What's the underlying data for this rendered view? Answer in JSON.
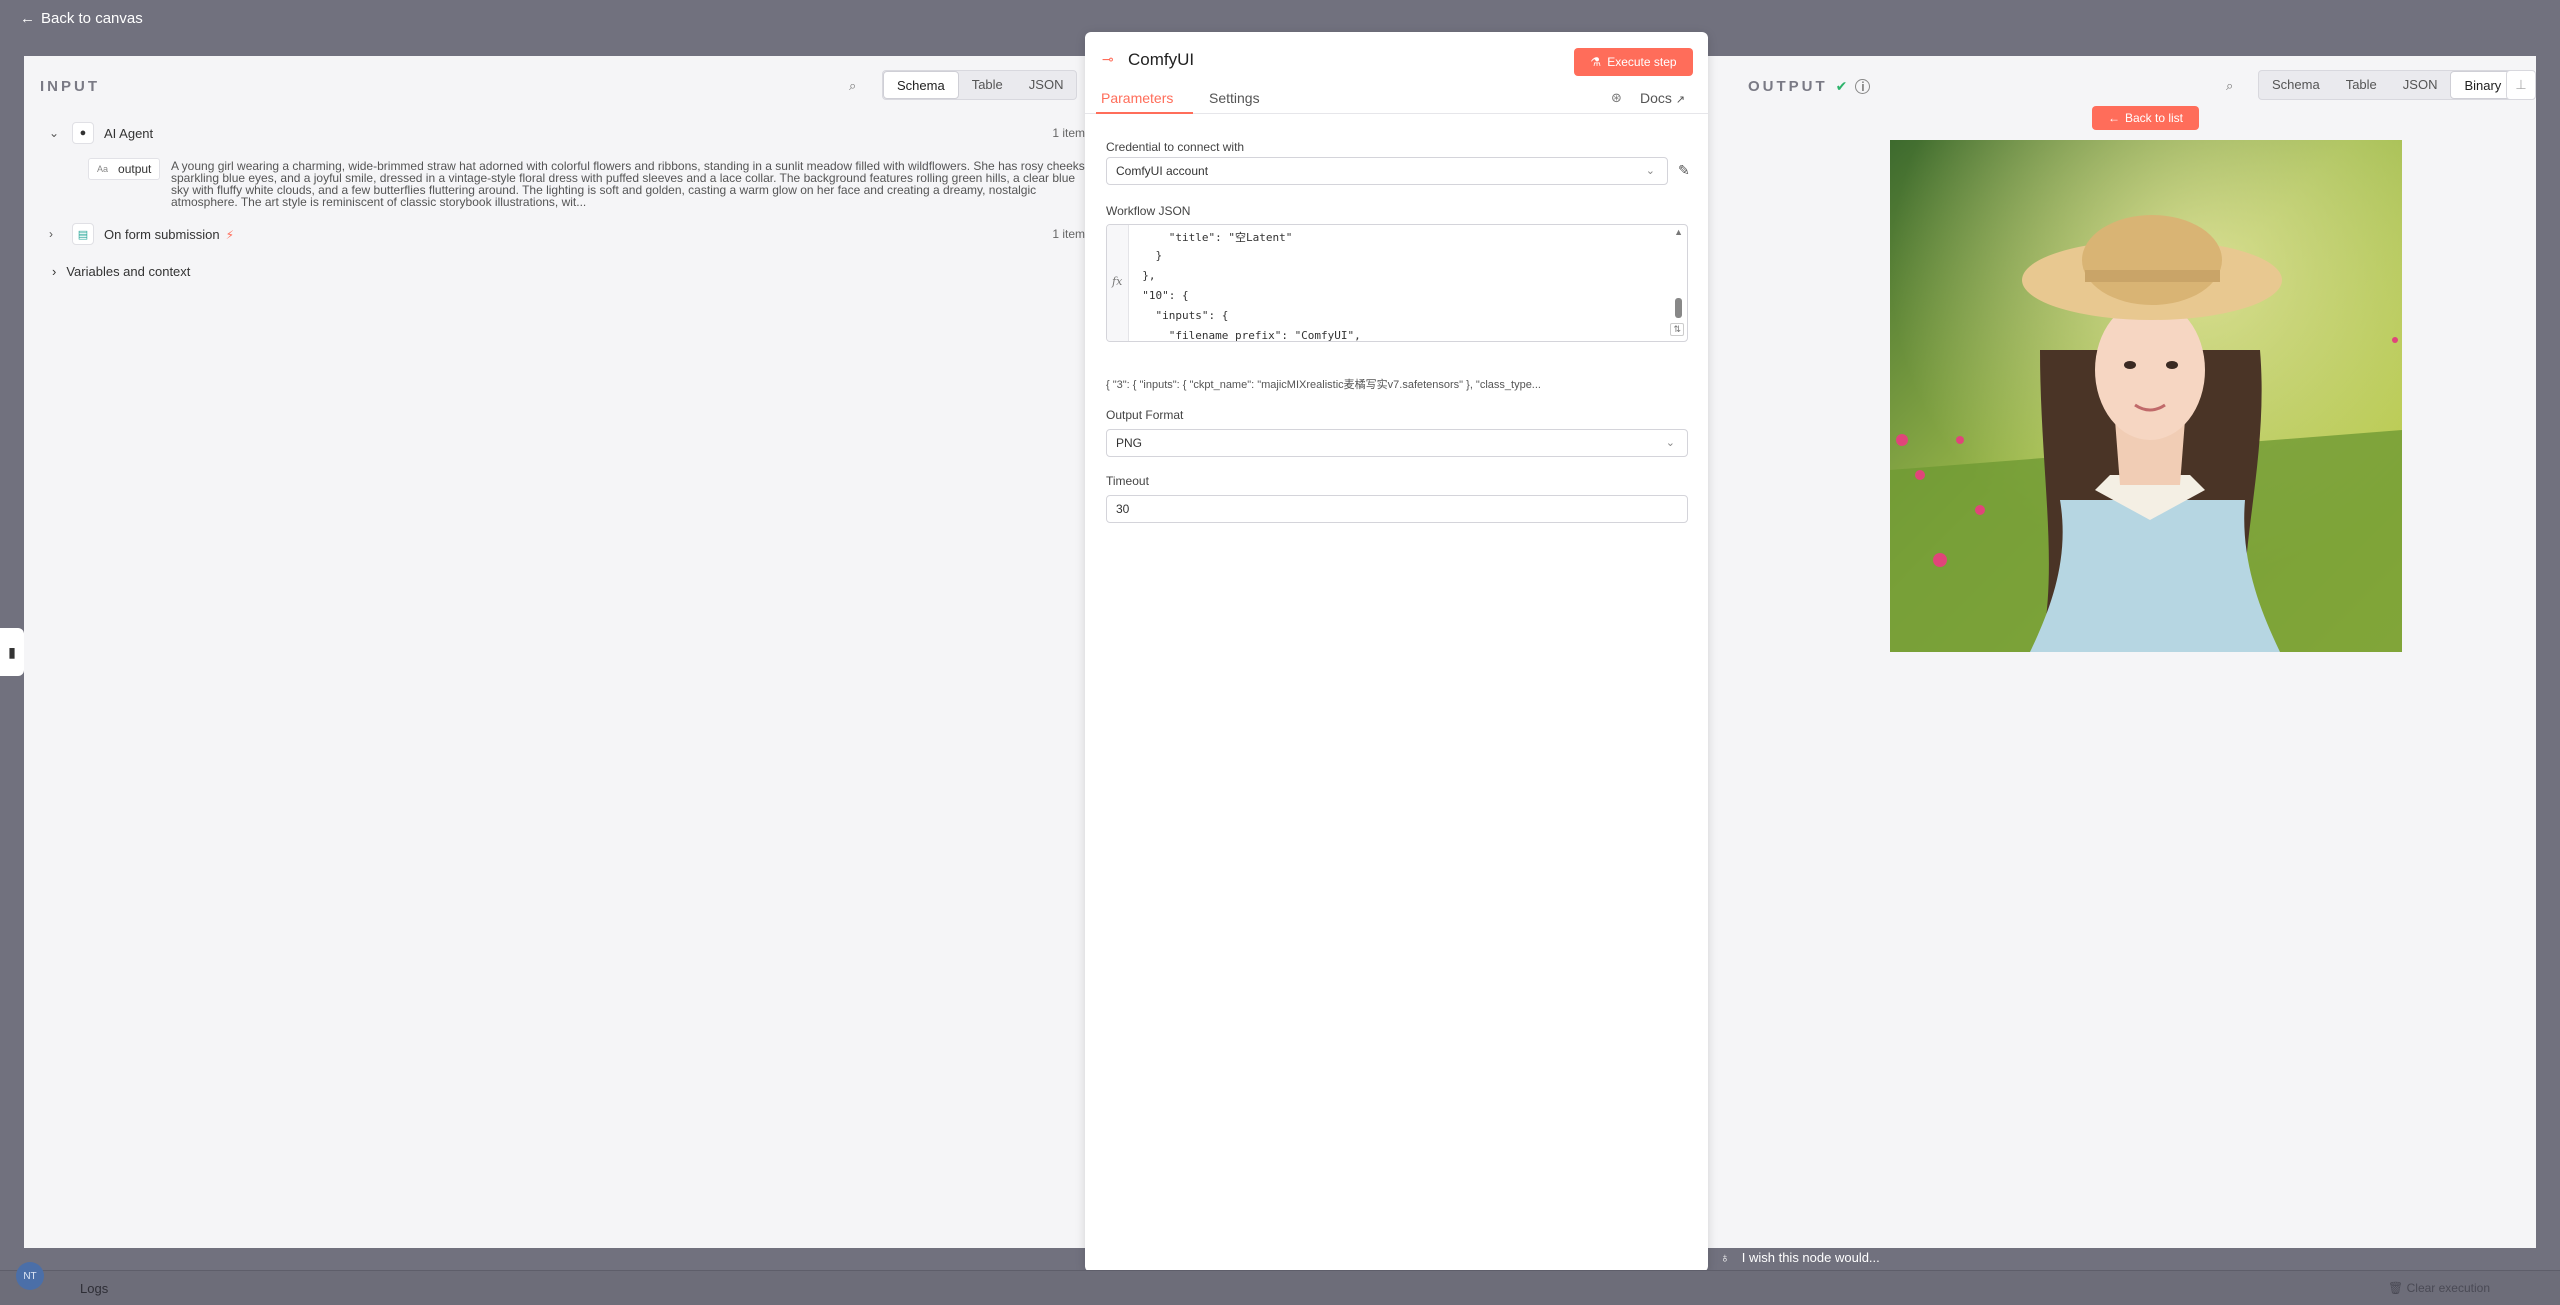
{
  "topbar": {
    "back_label": "Back to canvas"
  },
  "bottom": {
    "logs_label": "Logs",
    "clear_label": "Clear execution",
    "avatar_initials": "NT",
    "wish_label": "I wish this node would..."
  },
  "input": {
    "title": "INPUT",
    "tabs": [
      "Schema",
      "Table",
      "JSON"
    ],
    "active_tab": "Schema",
    "nodes": [
      {
        "label": "AI Agent",
        "count": "1 item"
      },
      {
        "label": "On form submission",
        "count": "1 item"
      }
    ],
    "output_field": {
      "name": "output",
      "type_glyph": "Aa"
    },
    "output_text": "A young girl wearing a charming, wide-brimmed straw hat adorned with colorful flowers and ribbons, standing in a sunlit meadow filled with wildflowers. She has rosy cheeks, sparkling blue eyes, and a joyful smile, dressed in a vintage-style floral dress with puffed sleeves and a lace collar. The background features rolling green hills, a clear blue sky with fluffy white clouds, and a few butterflies fluttering around. The lighting is soft and golden, casting a warm glow on her face and creating a dreamy, nostalgic atmosphere. The art style is reminiscent of classic storybook illustrations, wit...",
    "variables_label": "Variables and context"
  },
  "node": {
    "title": "ComfyUI",
    "execute_label": "Execute step",
    "tabs": {
      "parameters": "Parameters",
      "settings": "Settings"
    },
    "docs_label": "Docs",
    "credential_label": "Credential to connect with",
    "credential_value": "ComfyUI account",
    "workflow_label": "Workflow JSON",
    "code_lines": [
      "      \"title\": \"空Latent\"",
      "    }",
      "  },",
      "  \"10\": {",
      "    \"inputs\": {",
      "      \"filename_prefix\": \"ComfyUI\","
    ],
    "json_preview": "{   \"3\": {    \"inputs\": {      \"ckpt_name\": \"majicMIXrealistic麦橘写实v7.safetensors\"    },    \"class_type...",
    "output_format_label": "Output Format",
    "output_format_value": "PNG",
    "timeout_label": "Timeout",
    "timeout_value": "30"
  },
  "output": {
    "title": "OUTPUT",
    "tabs": [
      "Schema",
      "Table",
      "JSON",
      "Binary"
    ],
    "active_tab": "Binary",
    "back_list_label": "Back to list"
  },
  "colors": {
    "accent": "#ff6d5a",
    "success": "#2db36b"
  }
}
